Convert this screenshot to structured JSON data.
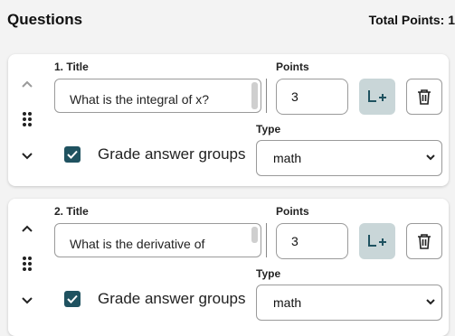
{
  "header": {
    "title": "Questions",
    "total_points_label": "Total Points: 1"
  },
  "labels": {
    "title": "Title",
    "points": "Points",
    "type": "Type",
    "grade_answer_groups": "Grade answer groups"
  },
  "questions": [
    {
      "number_title": "1. Title",
      "title_value": "What is the integral of x?",
      "points_value": "3",
      "grade_answer_groups_checked": true,
      "type_value": "math"
    },
    {
      "number_title": "2. Title",
      "title_value": "What is the derivative of",
      "points_value": "3",
      "grade_answer_groups_checked": true,
      "type_value": "math"
    }
  ],
  "colors": {
    "accent": "#1f5260",
    "add_button_bg": "#c9d6d8"
  },
  "icons": {
    "move_up": "chevron-up-icon",
    "drag": "drag-handle-icon",
    "move_down": "chevron-down-icon",
    "add_answer": "add-answer-icon",
    "delete": "trash-icon",
    "checkbox": "check-icon",
    "dropdown": "chevron-down-icon"
  }
}
